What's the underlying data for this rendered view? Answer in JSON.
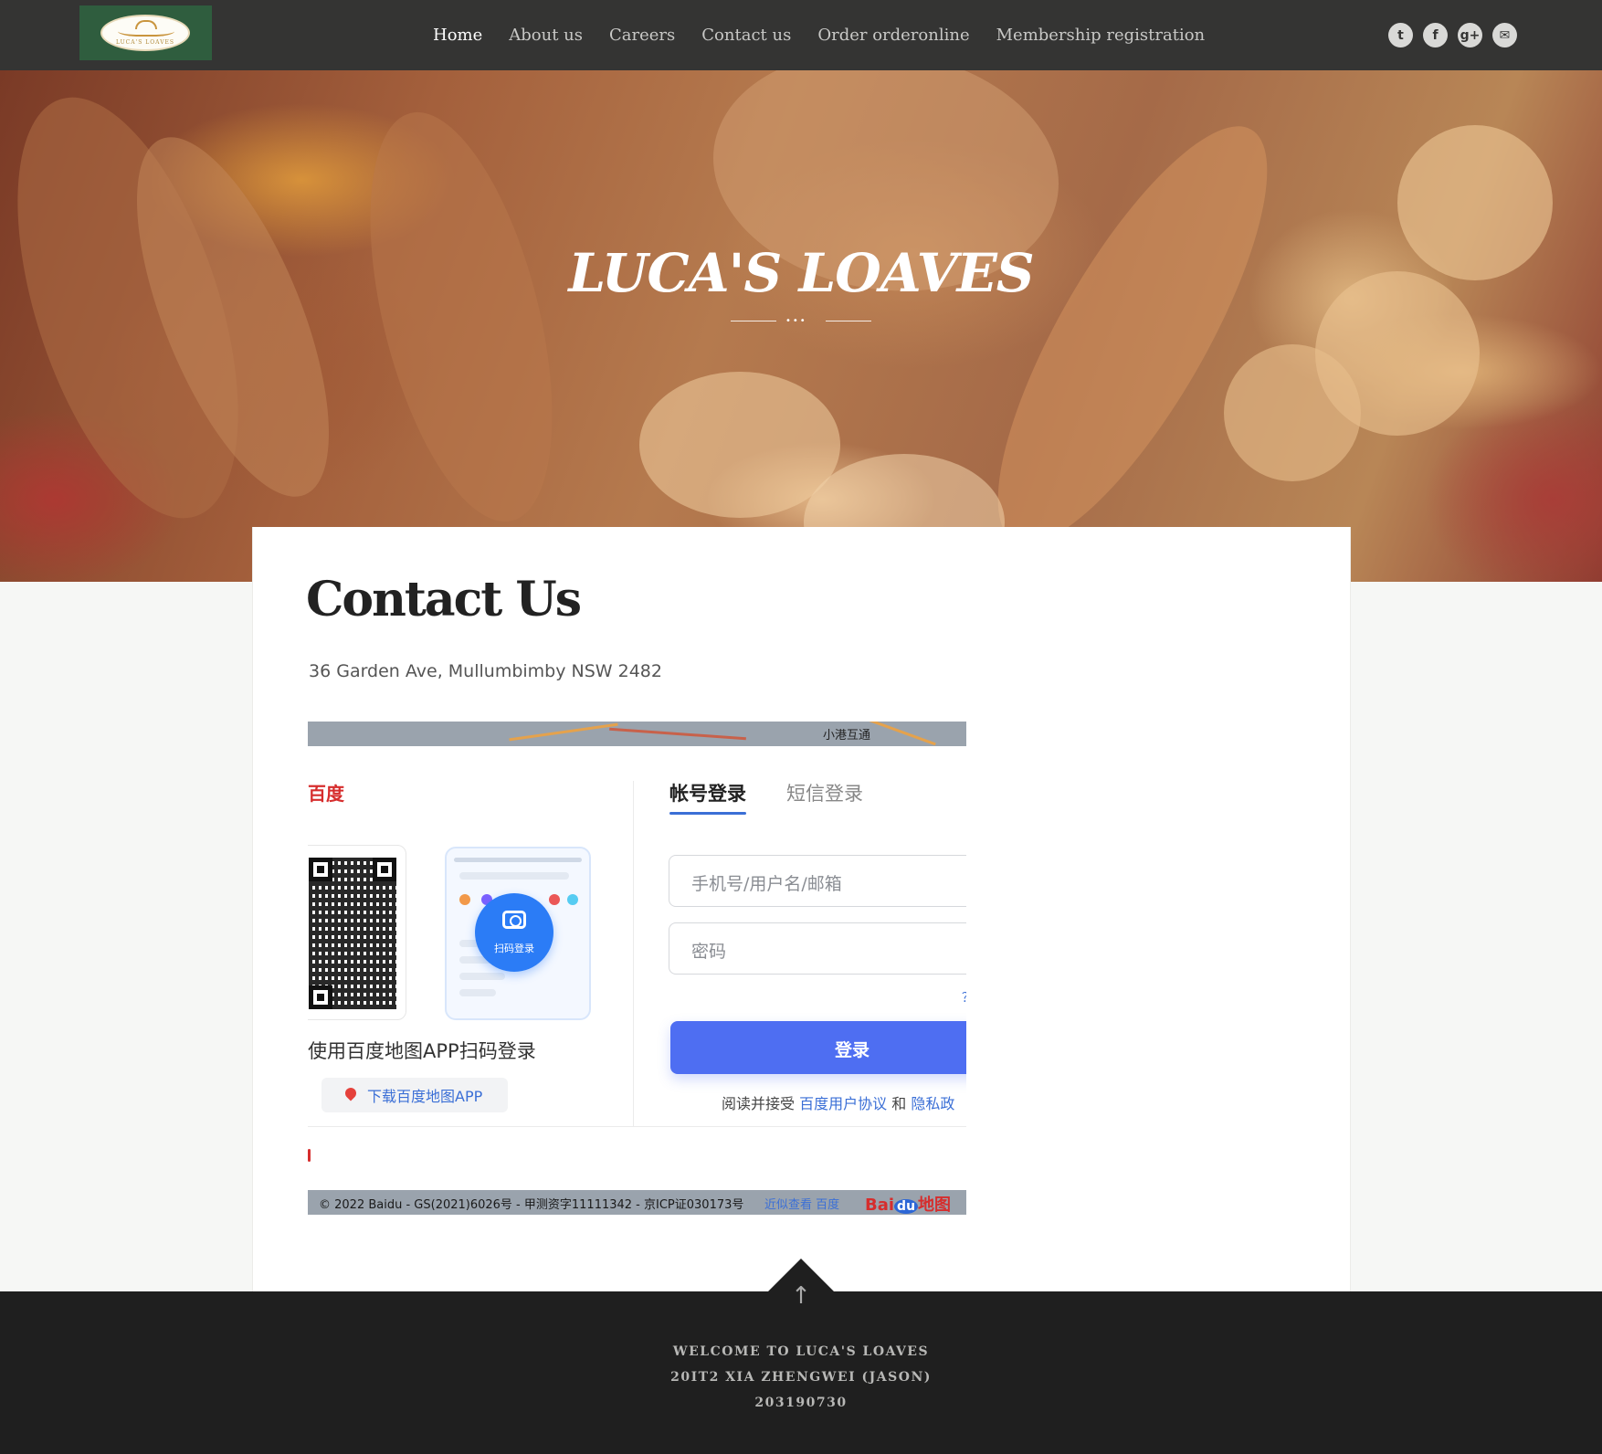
{
  "nav": {
    "logo_text": "LUCA'S LOAVES",
    "links": [
      "Home",
      "About us",
      "Careers",
      "Contact us",
      "Order orderonline",
      "Membership registration"
    ],
    "social": [
      "twitter-icon",
      "facebook-icon",
      "google-plus-icon",
      "mail-icon"
    ]
  },
  "hero": {
    "title": "LUCA'S LOAVES",
    "divider": "•••"
  },
  "contact": {
    "title": "Contact Us",
    "address": "36 Garden Ave, Mullumbimby NSW 2482"
  },
  "map": {
    "place_label": "小港互通",
    "brand": "百度",
    "qr_caption": "使用百度地图APP扫码登录",
    "scan_label": "扫码登录",
    "download_label": "下载百度地图APP",
    "tab_account": "帐号登录",
    "tab_sms": "短信登录",
    "username_placeholder": "手机号/用户名/邮箱",
    "password_placeholder": "密码",
    "forgot_fragment": "？",
    "login_button": "登录",
    "agree_prefix": "阅读并接受",
    "agree_link1": "百度用户协议",
    "agree_and": "和",
    "agree_link2": "隐私政",
    "copyright": "© 2022 Baidu - GS(2021)6026号 - 甲测资字11111342 - 京ICP证030173号",
    "footer_links": "近似查看  百度",
    "footer_logo_bai": "Bai",
    "footer_logo_du": "du",
    "footer_logo_map": "地图"
  },
  "footer": {
    "lines": [
      "WELCOME TO LUCA'S LOAVES",
      "20IT2 XIA ZHENGWEI (JASON)",
      "203190730"
    ],
    "arrow": "↑"
  },
  "colors": {
    "nav_bg": "#343433",
    "footer_bg": "#1f1f1f",
    "login_blue": "#4e6ef2",
    "link_blue": "#3b6fd6"
  }
}
